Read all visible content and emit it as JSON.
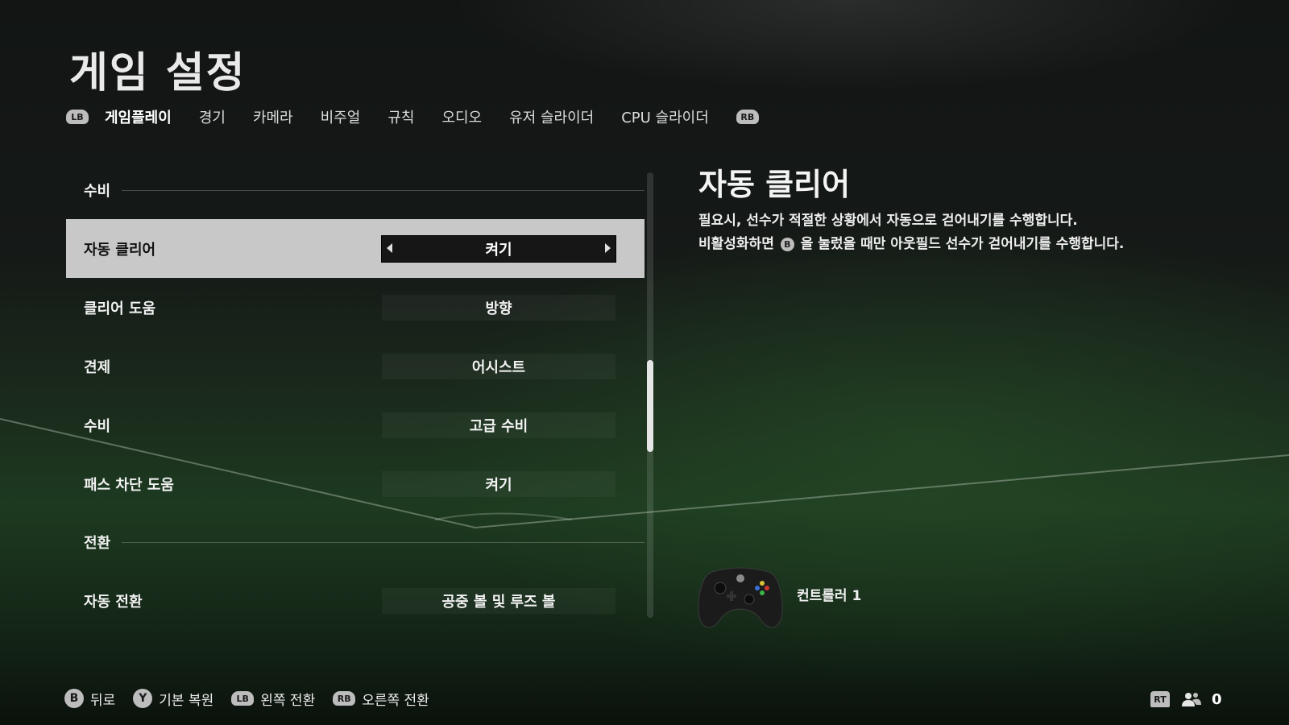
{
  "page": {
    "title": "게임 설정"
  },
  "tabs": {
    "prev_bumper": "LB",
    "next_bumper": "RB",
    "items": [
      {
        "label": "게임플레이",
        "active": true
      },
      {
        "label": "경기"
      },
      {
        "label": "카메라"
      },
      {
        "label": "비주얼"
      },
      {
        "label": "규칙"
      },
      {
        "label": "오디오"
      },
      {
        "label": "유저 슬라이더"
      },
      {
        "label": "CPU 슬라이더"
      }
    ]
  },
  "settings": {
    "section_defense": "수비",
    "rows": [
      {
        "label": "자동 클리어",
        "value": "켜기",
        "selected": true
      },
      {
        "label": "클리어 도움",
        "value": "방향"
      },
      {
        "label": "견제",
        "value": "어시스트"
      },
      {
        "label": "수비",
        "value": "고급 수비"
      },
      {
        "label": "패스 차단 도움",
        "value": "켜기"
      }
    ],
    "section_switching": "전환",
    "rows2": [
      {
        "label": "자동 전환",
        "value": "공중 볼 및 루즈 볼"
      }
    ]
  },
  "detail": {
    "title": "자동 클리어",
    "line1": "필요시, 선수가 적절한 상황에서 자동으로 걷어내기를 수행합니다.",
    "line2_before": "비활성화하면",
    "line2_button": "B",
    "line2_after": "을 눌렀을 때만 아웃필드 선수가 걷어내기를 수행합니다."
  },
  "controller": {
    "label": "컨트롤러 1"
  },
  "footer": {
    "actions": [
      {
        "button": "B",
        "label": "뒤로"
      },
      {
        "button": "Y",
        "label": "기본 복원"
      },
      {
        "button": "LB",
        "label": "왼쪽 전환"
      },
      {
        "button": "RB",
        "label": "오른쪽 전환"
      }
    ],
    "rt_button": "RT",
    "player_count": "0"
  },
  "colors": {
    "selected_row_bg": "#c8c8c8",
    "selected_value_bg": "#161616",
    "button_glyph_bg": "#bdbdbd",
    "pitch_green": "#1d3a20"
  },
  "icons": [
    "lb-bumper-icon",
    "rb-bumper-icon",
    "arrow-left-icon",
    "arrow-right-icon",
    "b-button-icon",
    "y-button-icon",
    "rt-trigger-icon",
    "people-icon",
    "xbox-controller-icon"
  ]
}
